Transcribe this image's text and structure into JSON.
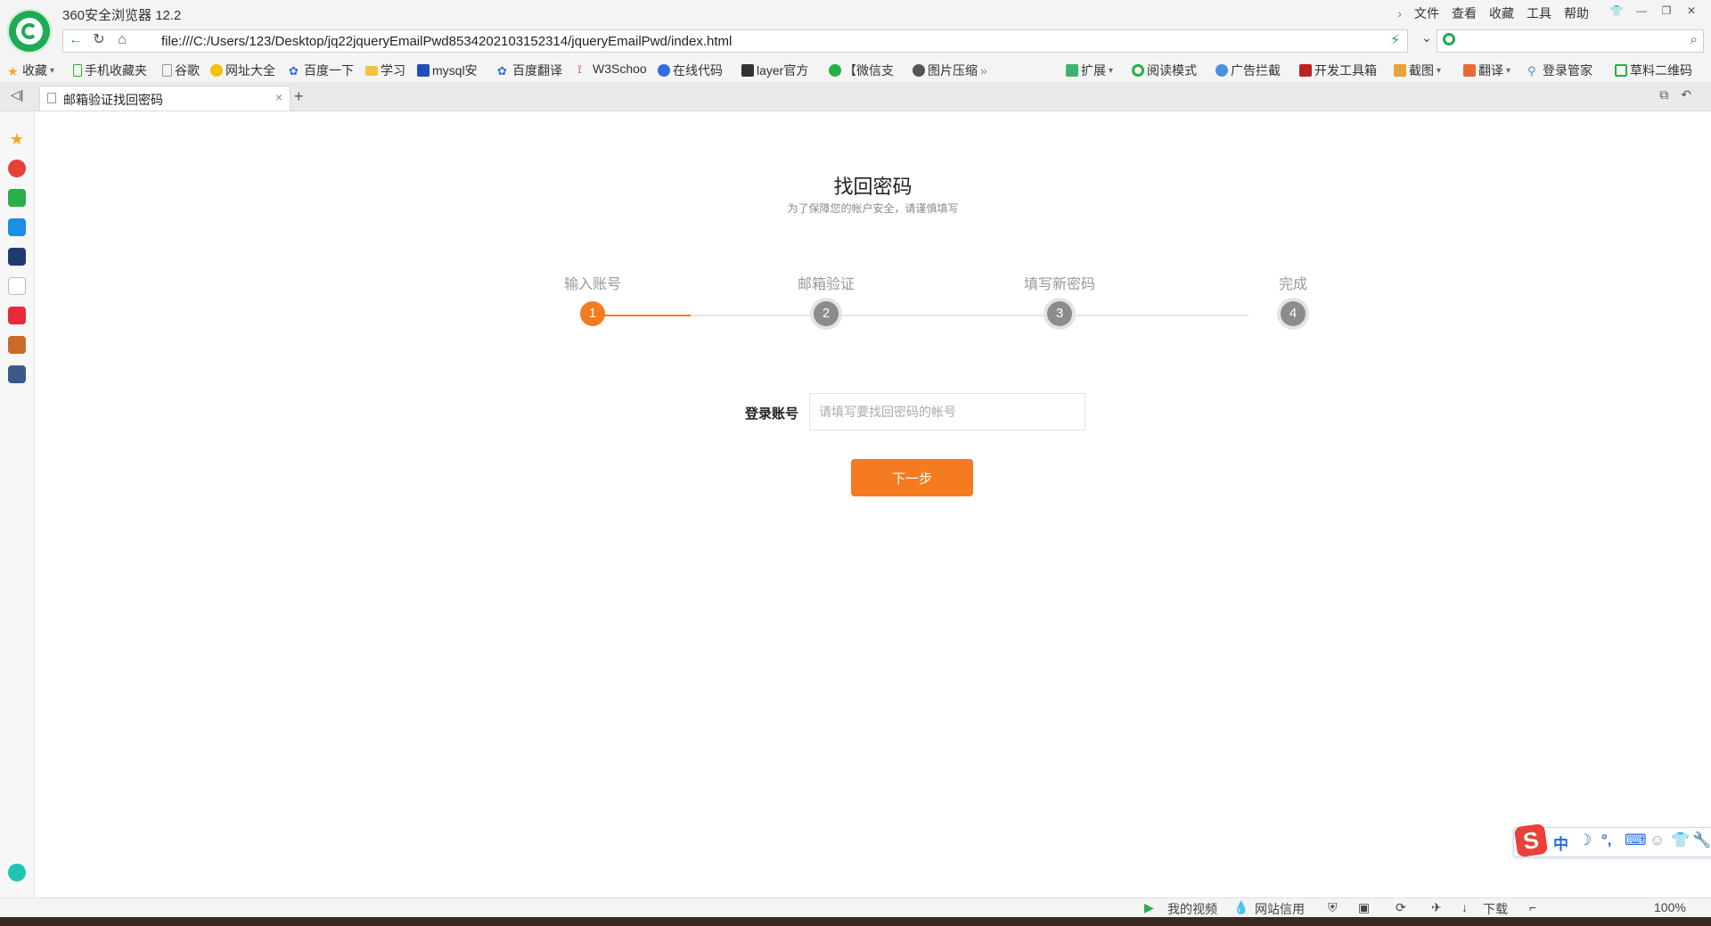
{
  "browser": {
    "title": "360安全浏览器 12.2",
    "menu": [
      "文件",
      "查看",
      "收藏",
      "工具",
      "帮助"
    ],
    "url": "file:///C:/Users/123/Desktop/jq22jqueryEmailPwd8534202103152314/jqueryEmailPwd/index.html"
  },
  "bookmarks": [
    "收藏",
    "手机收藏夹",
    "谷歌",
    "网址大全",
    "百度一下",
    "学习",
    "mysql安",
    "百度翻译",
    "W3Schoo",
    "在线代码",
    "layer官方",
    "【微信支",
    "图片压缩"
  ],
  "extensions": [
    "扩展",
    "阅读模式",
    "广告拦截",
    "开发工具箱",
    "截图",
    "翻译",
    "登录管家",
    "草料二维码"
  ],
  "tab": {
    "label": "邮箱验证找回密码"
  },
  "page": {
    "title": "找回密码",
    "subtitle": "为了保障您的帐户安全，请谨慎填写",
    "steps": [
      {
        "label": "输入账号",
        "number": "1",
        "state": "done"
      },
      {
        "label": "邮箱验证",
        "number": "2",
        "state": "todo"
      },
      {
        "label": "填写新密码",
        "number": "3",
        "state": "todo"
      },
      {
        "label": "完成",
        "number": "4",
        "state": "todo"
      }
    ],
    "form": {
      "label": "登录账号",
      "placeholder": "请填写要找回密码的帐号",
      "button": "下一步"
    }
  },
  "ime": {
    "items": [
      "中"
    ]
  },
  "status": {
    "items": [
      "我的视频",
      "网站信用",
      "下载"
    ],
    "zoom": "100%"
  },
  "colors": {
    "accent": "#f57b20",
    "brand": "#1faa55"
  }
}
